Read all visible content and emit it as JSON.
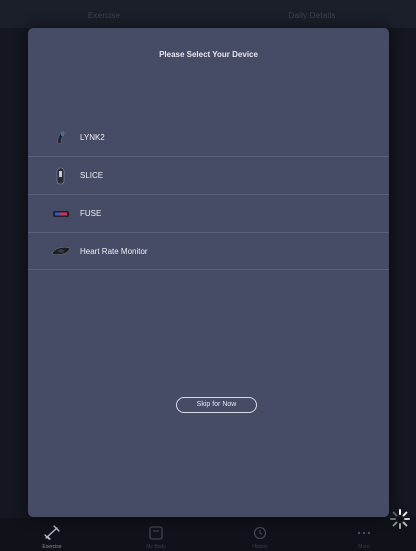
{
  "background": {
    "top_tabs": [
      "Exercise",
      "Daily Details"
    ],
    "bottom_tabs": [
      {
        "label": "Exercise",
        "icon": "exercise-icon",
        "active": true
      },
      {
        "label": "My Body",
        "icon": "scale-icon",
        "active": false
      },
      {
        "label": "History",
        "icon": "history-icon",
        "active": false
      },
      {
        "label": "More",
        "icon": "more-icon",
        "active": false
      }
    ]
  },
  "modal": {
    "title": "Please Select Your Device",
    "devices": [
      {
        "name": "LYNK2",
        "icon": "lynk2-device-icon"
      },
      {
        "name": "SLICE",
        "icon": "slice-device-icon"
      },
      {
        "name": "FUSE",
        "icon": "fuse-device-icon"
      },
      {
        "name": "Heart Rate Monitor",
        "icon": "heart-rate-monitor-icon"
      }
    ],
    "skip_label": "Skip for Now"
  },
  "colors": {
    "modal_bg": "#464b66",
    "screen_bg": "#14171f",
    "divider": "#5a5f7c",
    "text": "#eef0f6"
  }
}
